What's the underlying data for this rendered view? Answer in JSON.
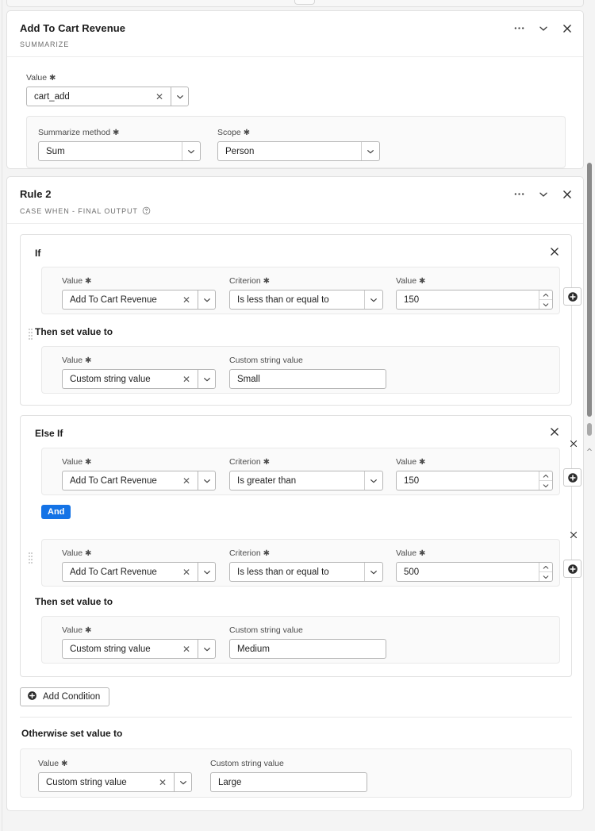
{
  "summarize_card": {
    "title": "Add To Cart Revenue",
    "subtitle": "SUMMARIZE",
    "value_label": "Value",
    "value": "cart_add",
    "summarize_method_label": "Summarize method",
    "summarize_method": "Sum",
    "scope_label": "Scope",
    "scope": "Person"
  },
  "rule_card": {
    "title": "Rule 2",
    "subtitle": "CASE WHEN - FINAL OUTPUT",
    "if_label": "If",
    "else_if_label": "Else If",
    "then_label": "Then set value to",
    "otherwise_label": "Otherwise set value to",
    "add_condition_label": "Add Condition",
    "and_label": "And",
    "labels": {
      "value": "Value",
      "criterion": "Criterion",
      "custom_string_value": "Custom string value"
    },
    "if_block": {
      "conditions": [
        {
          "value": "Add To Cart Revenue",
          "criterion": "Is less than or equal to",
          "number": "150"
        }
      ],
      "then": {
        "value": "Custom string value",
        "custom_string": "Small"
      }
    },
    "else_if_block": {
      "conditions": [
        {
          "value": "Add To Cart Revenue",
          "criterion": "Is greater than",
          "number": "150"
        },
        {
          "value": "Add To Cart Revenue",
          "criterion": "Is less than or equal to",
          "number": "500"
        }
      ],
      "then": {
        "value": "Custom string value",
        "custom_string": "Medium"
      }
    },
    "otherwise": {
      "value": "Custom string value",
      "custom_string": "Large"
    }
  },
  "icons": {
    "more": "more-horizontal-icon",
    "collapse": "chevron-down-icon",
    "close": "close-icon",
    "help": "help-circle-icon",
    "clear": "clear-x-icon",
    "add": "add-circle-icon"
  },
  "colors": {
    "accent": "#1473e6",
    "background": "#f4f4f4",
    "card": "#ffffff",
    "border": "#e1e1e1"
  }
}
